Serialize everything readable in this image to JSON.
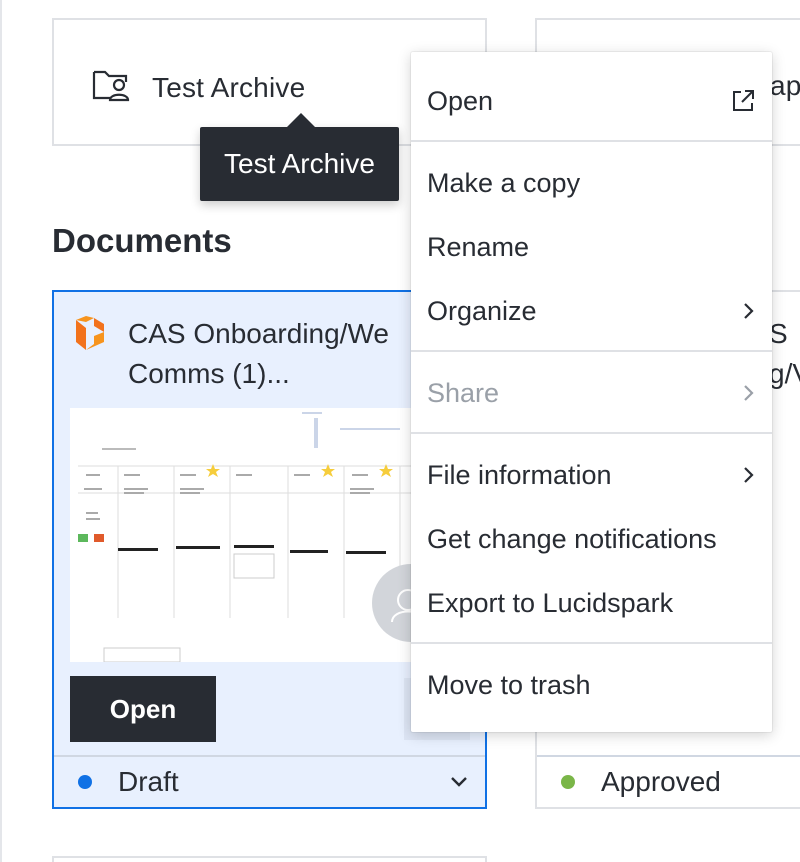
{
  "folders": [
    {
      "name": "Test Archive",
      "icon": "shared-folder-icon"
    },
    {
      "name": "ap",
      "icon": "shared-folder-icon"
    }
  ],
  "tooltip": {
    "text": "Test Archive"
  },
  "section": {
    "title": "Documents"
  },
  "documents": [
    {
      "title": "CAS Onboarding/We… Comms (1)...",
      "title_line1": "CAS Onboarding/We",
      "title_line2": "Comms (1)...",
      "open_label": "Open",
      "status": "Draft",
      "status_color": "#1071e5"
    },
    {
      "title_line1": "S",
      "title_line2": "g/V",
      "status": "Approved",
      "status_color": "#7ab648"
    }
  ],
  "context_menu": {
    "items": [
      {
        "label": "Open",
        "icon": "open-external-icon"
      },
      {
        "label": "Make a copy"
      },
      {
        "label": "Rename"
      },
      {
        "label": "Organize",
        "icon": "chevron-right-icon"
      },
      {
        "label": "Share",
        "icon": "chevron-right-icon",
        "disabled": true
      },
      {
        "label": "File information",
        "icon": "chevron-right-icon"
      },
      {
        "label": "Get change notifications"
      },
      {
        "label": "Export to Lucidspark"
      },
      {
        "label": "Move to trash"
      }
    ]
  },
  "colors": {
    "accent": "#1071e5",
    "dark": "#282c33",
    "brand_orange": "#f2721c"
  }
}
